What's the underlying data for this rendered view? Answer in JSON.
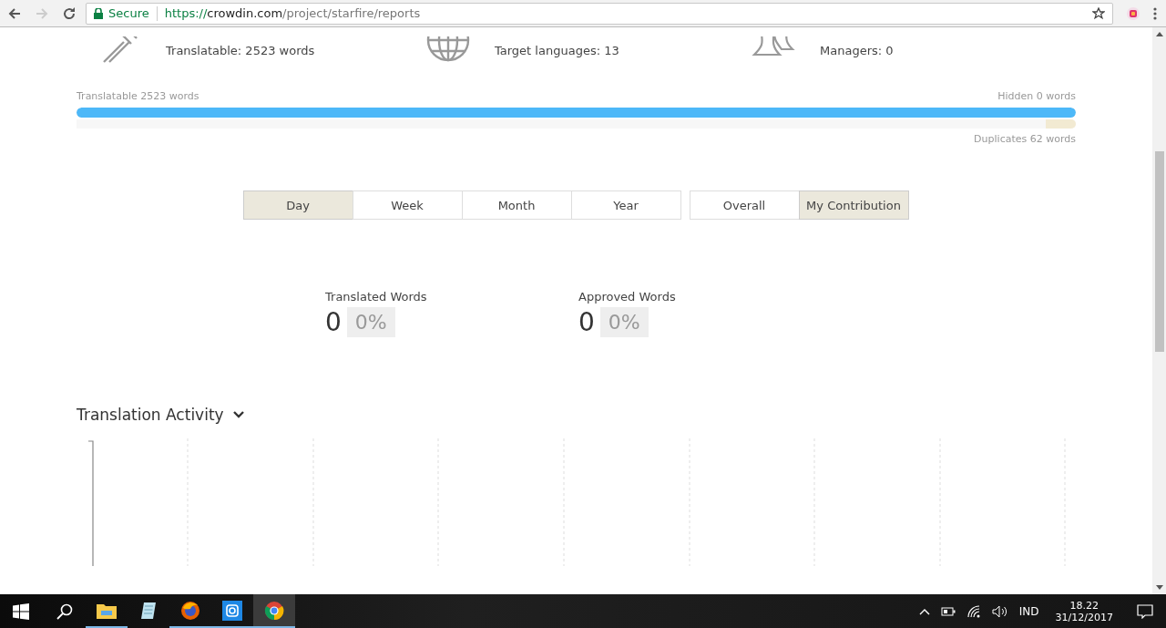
{
  "browser": {
    "secure_label": "Secure",
    "url": {
      "scheme": "https://",
      "host": "crowdin.com",
      "path": "/project/starfire/reports"
    }
  },
  "summary": [
    {
      "kind": "tools",
      "text": "Translatable: 2523 words"
    },
    {
      "kind": "globe",
      "text": "Target languages: 13"
    },
    {
      "kind": "people",
      "text": "Managers: 0"
    }
  ],
  "progress": {
    "left_label": "Translatable 2523 words",
    "right_label": "Hidden 0 words",
    "level": 1,
    "duplicates": {
      "level": 0.03,
      "label": "Duplicates 62 words"
    }
  },
  "period_tabs": [
    {
      "label": "Day",
      "selected": true
    },
    {
      "label": "Week",
      "selected": false
    },
    {
      "label": "Month",
      "selected": false
    },
    {
      "label": "Year",
      "selected": false
    }
  ],
  "scope_tabs": [
    {
      "label": "Overall",
      "selected": false
    },
    {
      "label": "My Contribution",
      "selected": true
    }
  ],
  "stats": [
    {
      "label": "Translated Words",
      "value": "0",
      "percent": "0%"
    },
    {
      "label": "Approved Words",
      "value": "0",
      "percent": "0%"
    }
  ],
  "activity": {
    "title": "Translation Activity"
  },
  "taskbar": {
    "apps": [
      {
        "kind": "explorer",
        "running": true,
        "active": false
      },
      {
        "kind": "notes",
        "running": false,
        "active": false
      },
      {
        "kind": "firefox",
        "running": true,
        "active": false
      },
      {
        "kind": "camera",
        "running": true,
        "active": false
      },
      {
        "kind": "chrome",
        "running": true,
        "active": true
      }
    ],
    "language": "IND",
    "time": "18.22",
    "date": "31/12/2017"
  }
}
